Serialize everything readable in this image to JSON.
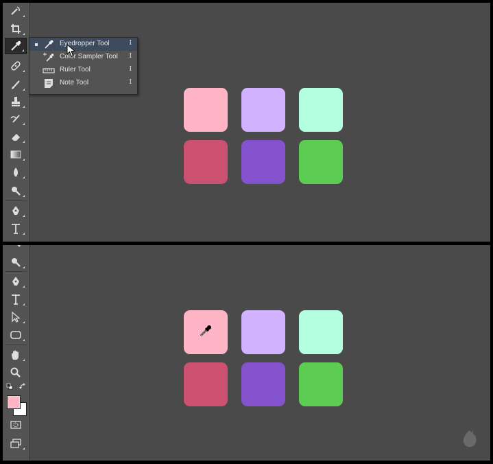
{
  "flyout": {
    "items": [
      {
        "label": "Eyedropper Tool",
        "shortcut": "I",
        "selected": true,
        "icon": "eyedropper-icon"
      },
      {
        "label": "Color Sampler Tool",
        "shortcut": "I",
        "selected": false,
        "icon": "color-sampler-icon"
      },
      {
        "label": "Ruler Tool",
        "shortcut": "I",
        "selected": false,
        "icon": "ruler-icon"
      },
      {
        "label": "Note Tool",
        "shortcut": "I",
        "selected": false,
        "icon": "note-icon"
      }
    ]
  },
  "swatch_colors": [
    "#ffb5c6",
    "#d2b3ff",
    "#b3ffdf",
    "#cc5170",
    "#8452cc",
    "#5ccc52"
  ],
  "foreground_color": "#ffb5c6",
  "background_color": "#ffffff",
  "colors": {
    "canvas": "#4a4a4a",
    "toolbar": "#535353",
    "menu_selected": "#3e4b5e"
  }
}
